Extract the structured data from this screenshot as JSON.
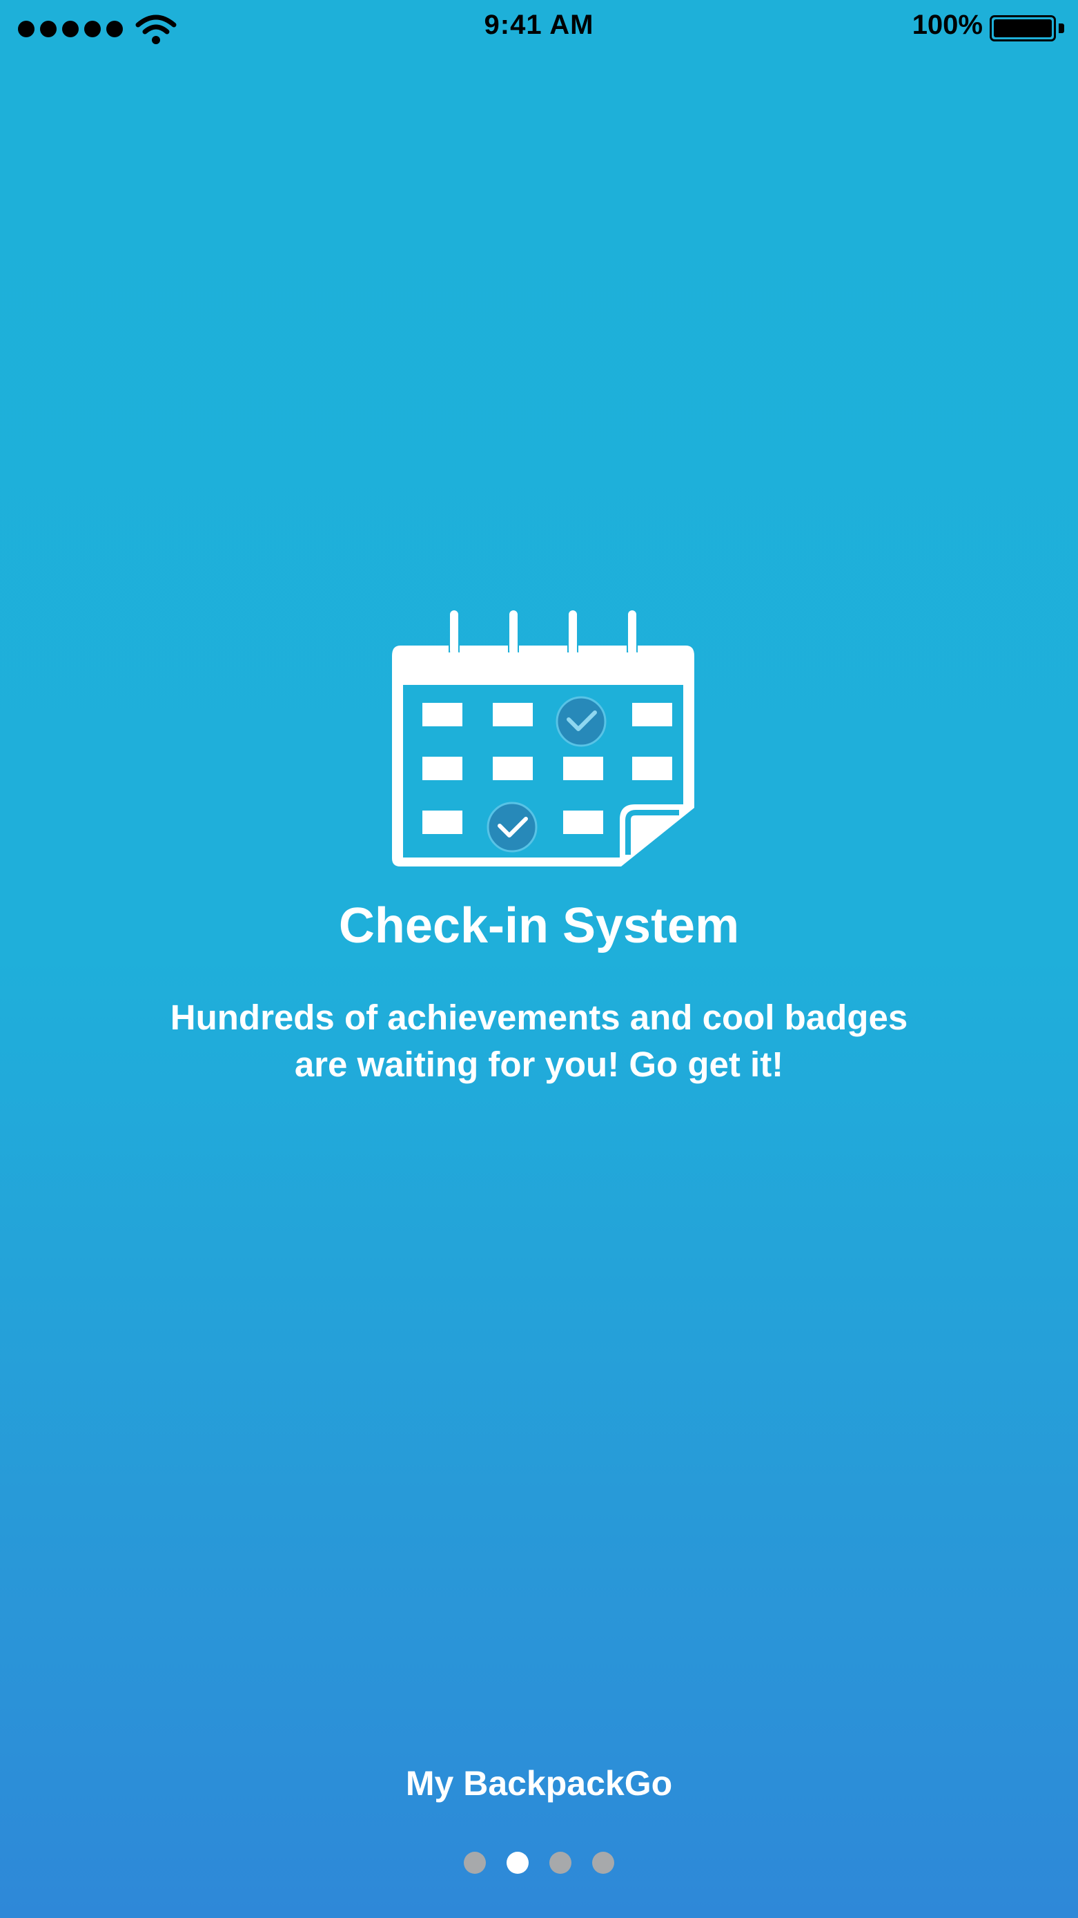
{
  "status_bar": {
    "time": "9:41 AM",
    "battery_percent": "100%",
    "signal_bars": 5,
    "icons": [
      "signal-dots-icon",
      "wifi-icon",
      "battery-icon"
    ]
  },
  "onboarding": {
    "illustration_icon": "calendar-check-icon",
    "title": "Check-in System",
    "description_line1": "Hundreds of achievements and cool badges",
    "description_line2": "are waiting for you! Go get it!",
    "app_name": "My BackpackGo",
    "page_count": 4,
    "current_page": 2
  },
  "colors": {
    "background_top": "#1eb0d9",
    "background_bottom": "#2e88d8",
    "text": "#ffffff",
    "check_circle": "#2789b9",
    "page_dot_inactive": "#a7a9ab",
    "page_dot_active": "#ffffff"
  }
}
